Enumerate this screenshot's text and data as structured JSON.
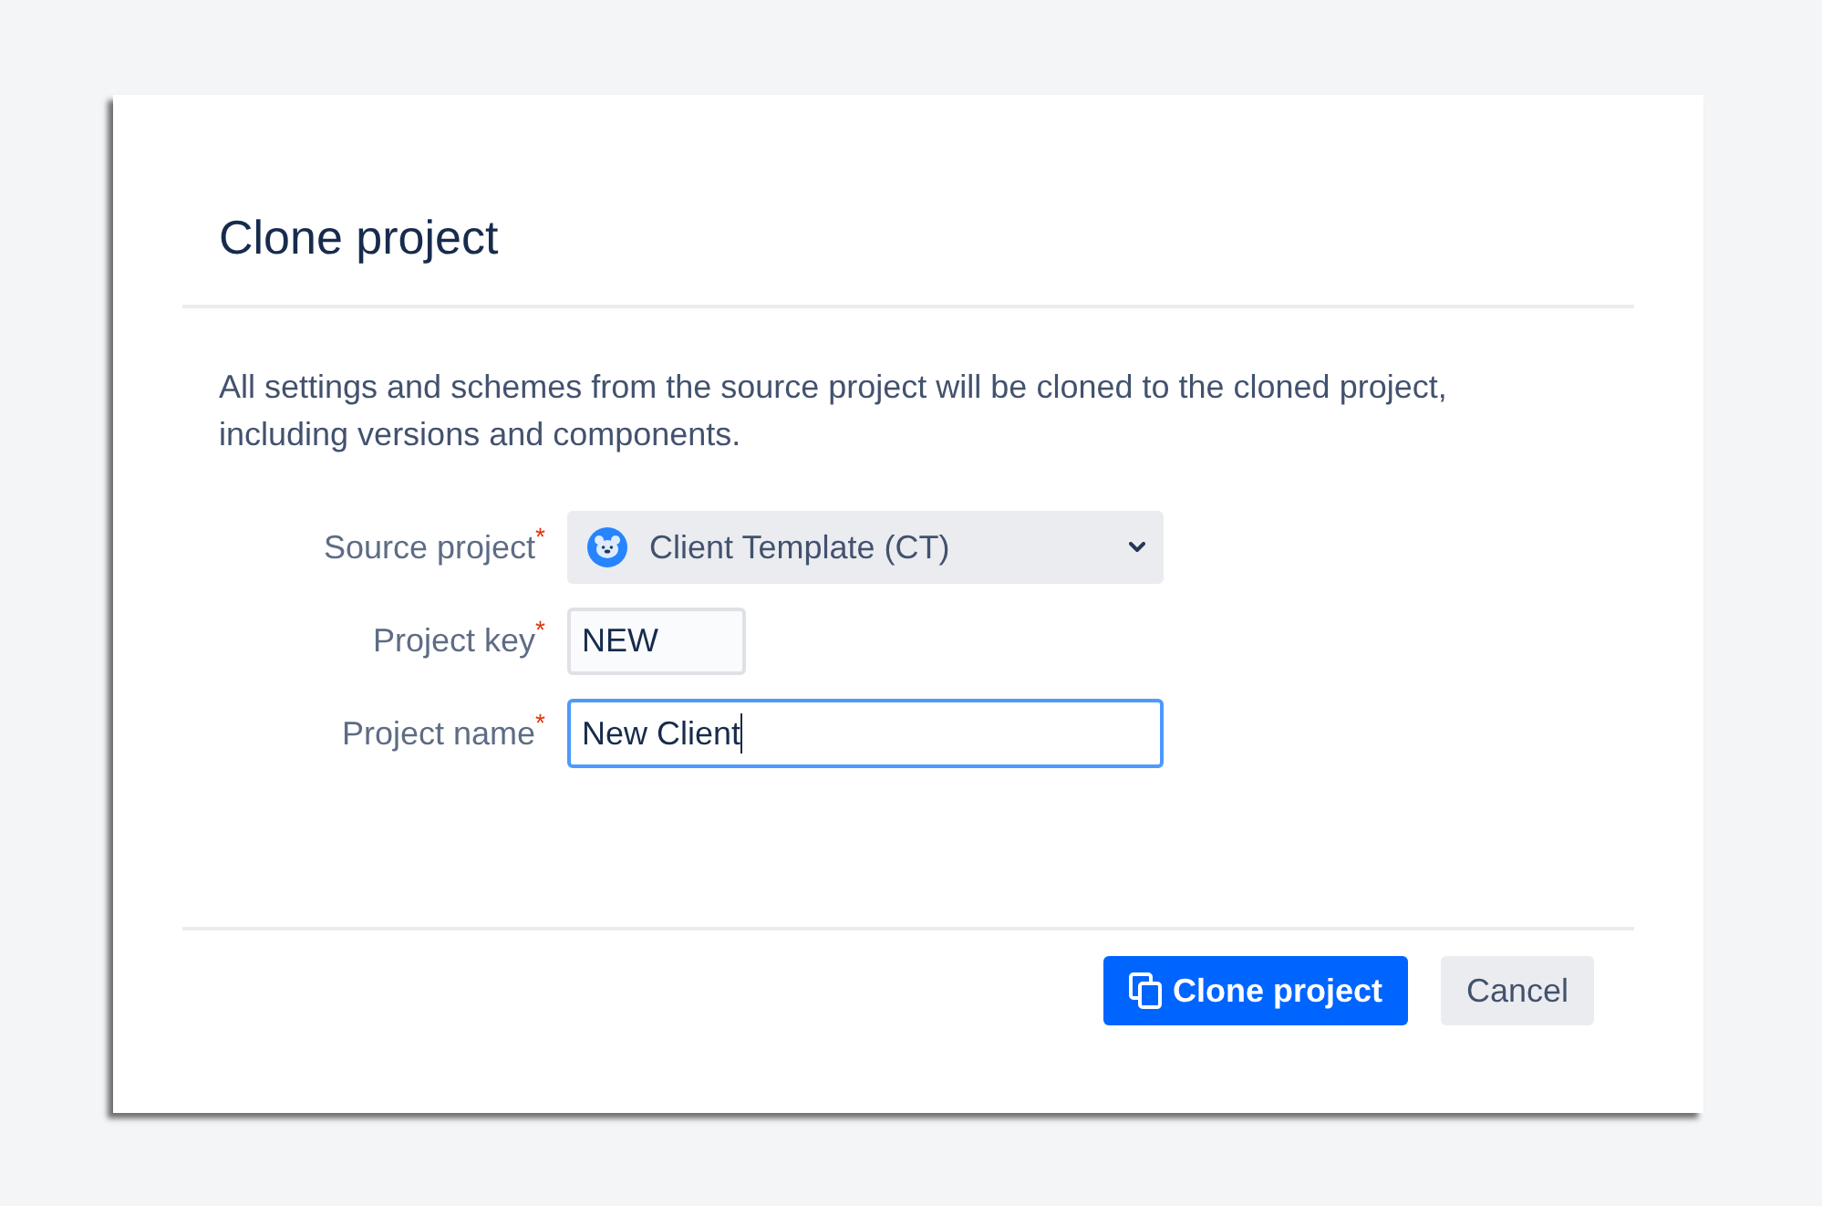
{
  "dialog": {
    "title": "Clone project",
    "description": "All settings and schemes from the source project will be cloned to the cloned project, including versions and components."
  },
  "fields": [
    {
      "kind": "select",
      "label": "Source project",
      "required": true,
      "value": "Client Template (CT)",
      "focused": false
    },
    {
      "kind": "text",
      "label": "Project key",
      "required": true,
      "value": "NEW",
      "focused": false
    },
    {
      "kind": "text",
      "label": "Project name",
      "required": true,
      "value": "New Client",
      "focused": true
    }
  ],
  "required_mark": "*",
  "buttons": [
    {
      "kind": "primary",
      "label": "Clone project"
    },
    {
      "kind": "secondary",
      "label": "Cancel"
    }
  ]
}
